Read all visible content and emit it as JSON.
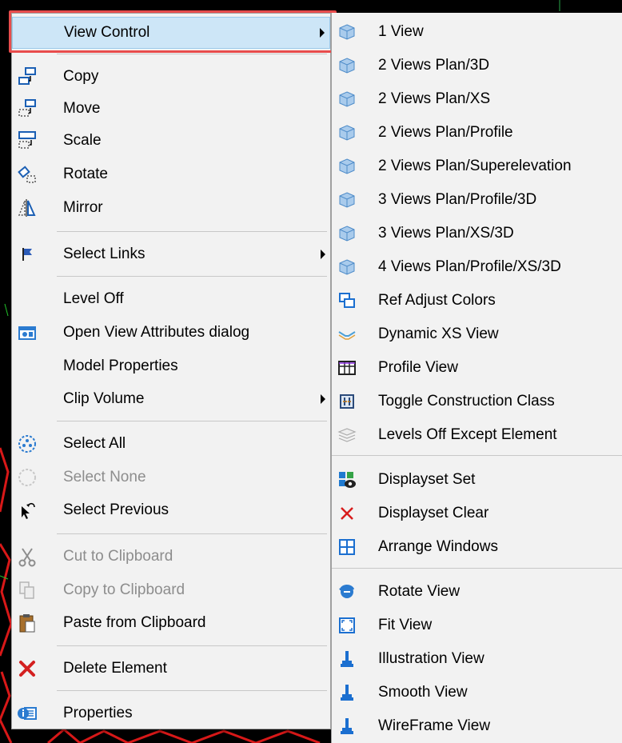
{
  "left_menu": {
    "items": [
      {
        "label": "View Control",
        "icon": "none",
        "submenu": true,
        "highlighted": true
      },
      {
        "label": "Copy",
        "icon": "copy-icon"
      },
      {
        "label": "Move",
        "icon": "move-icon"
      },
      {
        "label": "Scale",
        "icon": "scale-icon"
      },
      {
        "label": "Rotate",
        "icon": "rotate-icon"
      },
      {
        "label": "Mirror",
        "icon": "mirror-icon"
      },
      {
        "label": "Select Links",
        "icon": "flag-icon",
        "submenu": true
      },
      {
        "label": "Level Off",
        "icon": "none"
      },
      {
        "label": "Open View Attributes dialog",
        "icon": "view-attributes-icon"
      },
      {
        "label": "Model Properties",
        "icon": "none"
      },
      {
        "label": "Clip Volume",
        "icon": "none",
        "submenu": true
      },
      {
        "label": "Select All",
        "icon": "select-all-icon"
      },
      {
        "label": "Select None",
        "icon": "select-none-icon",
        "disabled": true
      },
      {
        "label": "Select Previous",
        "icon": "select-previous-icon"
      },
      {
        "label": "Cut to Clipboard",
        "icon": "scissors-icon",
        "disabled": true
      },
      {
        "label": "Copy to Clipboard",
        "icon": "copy-clipboard-icon",
        "disabled": true
      },
      {
        "label": "Paste from Clipboard",
        "icon": "paste-icon"
      },
      {
        "label": "Delete Element",
        "icon": "delete-icon"
      },
      {
        "label": "Properties",
        "icon": "properties-icon"
      }
    ]
  },
  "right_menu": {
    "items": [
      {
        "label": "1 View",
        "icon": "cube-icon"
      },
      {
        "label": "2 Views Plan/3D",
        "icon": "cube-icon"
      },
      {
        "label": "2 Views Plan/XS",
        "icon": "cube-icon"
      },
      {
        "label": "2 Views Plan/Profile",
        "icon": "cube-icon"
      },
      {
        "label": "2 Views Plan/Superelevation",
        "icon": "cube-icon"
      },
      {
        "label": "3 Views Plan/Profile/3D",
        "icon": "cube-icon"
      },
      {
        "label": "3 Views Plan/XS/3D",
        "icon": "cube-icon"
      },
      {
        "label": "4 Views Plan/Profile/XS/3D",
        "icon": "cube-icon"
      },
      {
        "label": "Ref Adjust Colors",
        "icon": "ref-adjust-icon"
      },
      {
        "label": "Dynamic XS View",
        "icon": "dynamic-xs-icon"
      },
      {
        "label": "Profile View",
        "icon": "profile-grid-icon"
      },
      {
        "label": "Toggle Construction Class",
        "icon": "construction-class-icon"
      },
      {
        "label": "Levels Off Except Element",
        "icon": "layers-icon"
      },
      {
        "label": "Displayset Set",
        "icon": "displayset-icon"
      },
      {
        "label": "Displayset Clear",
        "icon": "x-icon"
      },
      {
        "label": "Arrange Windows",
        "icon": "arrange-windows-icon"
      },
      {
        "label": "Rotate View",
        "icon": "rotate-view-icon"
      },
      {
        "label": "Fit View",
        "icon": "fit-view-icon"
      },
      {
        "label": "Illustration View",
        "icon": "brush-icon"
      },
      {
        "label": "Smooth View",
        "icon": "brush-icon"
      },
      {
        "label": "WireFrame View",
        "icon": "brush-icon"
      }
    ]
  },
  "colors": {
    "highlight_border": "#e84c4c",
    "selected_bg": "#cde6f7",
    "menu_bg": "#f2f2f2",
    "disabled_text": "#8d8d8d"
  }
}
